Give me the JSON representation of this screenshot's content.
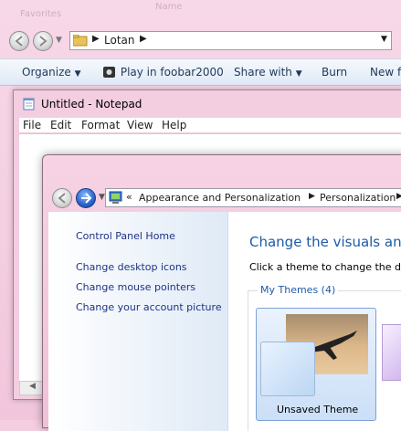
{
  "explorer": {
    "ghost_text": [
      "Favorites",
      "Name",
      "Name",
      "Name"
    ],
    "breadcrumb": {
      "folder": "Lotan"
    },
    "toolbar": {
      "organize": "Organize",
      "play": "Play in foobar2000",
      "share": "Share with",
      "burn": "Burn",
      "new_folder": "New fo"
    }
  },
  "notepad": {
    "title": "Untitled - Notepad",
    "menu": [
      "File",
      "Edit",
      "Format",
      "View",
      "Help"
    ]
  },
  "control_panel": {
    "breadcrumb": {
      "overflow": "«",
      "parent": "Appearance and Personalization",
      "current": "Personalization"
    },
    "sidebar": {
      "home": "Control Panel Home",
      "links": [
        "Change desktop icons",
        "Change mouse pointers",
        "Change your account picture"
      ]
    },
    "main": {
      "heading": "Change the visuals and s",
      "subtext": "Click a theme to change the desk",
      "group_title": "My Themes (4)",
      "theme_label": "Unsaved Theme"
    }
  },
  "colors": {
    "link": "#1e3287",
    "heading": "#1e5aa8",
    "accent_blue": "#2a62c8"
  }
}
